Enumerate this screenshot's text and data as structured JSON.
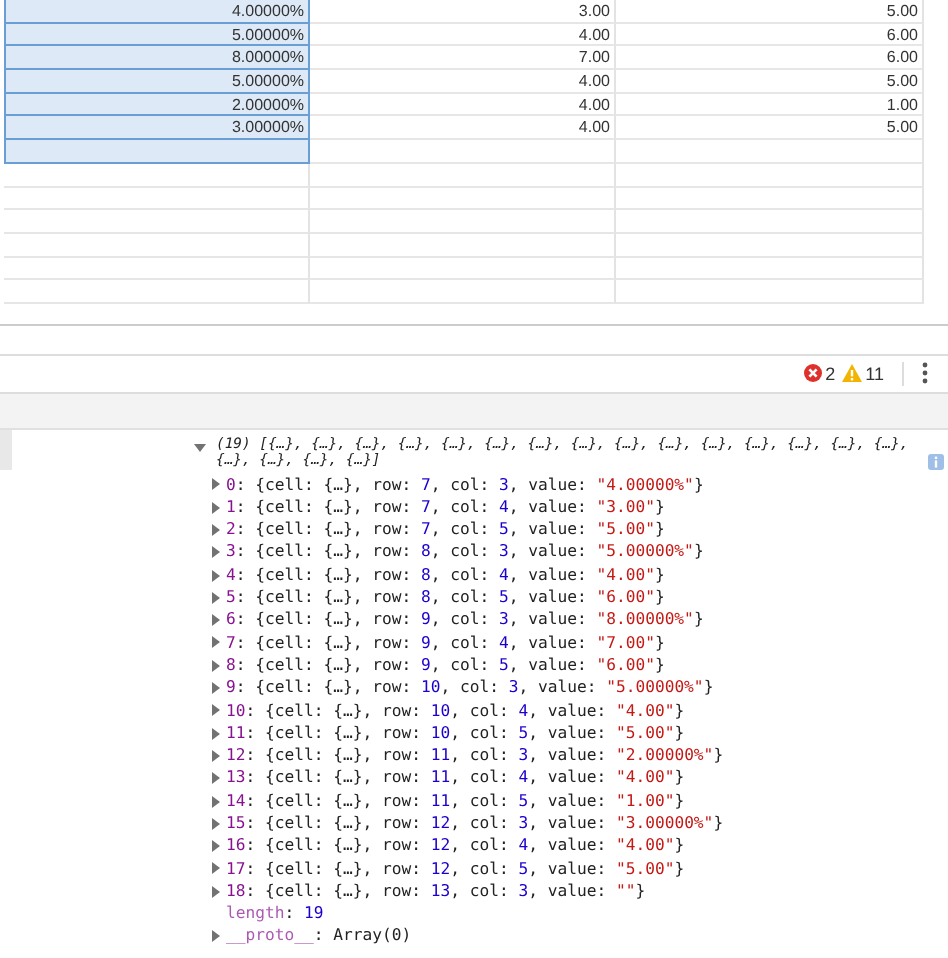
{
  "sheet": {
    "rows": [
      {
        "selected": true,
        "cells": [
          "4.00000%",
          "3.00",
          "5.00"
        ]
      },
      {
        "selected": true,
        "cells": [
          "5.00000%",
          "4.00",
          "6.00"
        ]
      },
      {
        "selected": true,
        "cells": [
          "8.00000%",
          "7.00",
          "6.00"
        ]
      },
      {
        "selected": true,
        "cells": [
          "5.00000%",
          "4.00",
          "5.00"
        ]
      },
      {
        "selected": true,
        "cells": [
          "2.00000%",
          "4.00",
          "1.00"
        ]
      },
      {
        "selected": true,
        "cells": [
          "3.00000%",
          "4.00",
          "5.00"
        ]
      }
    ],
    "empty_rows": [
      {
        "selected": true
      },
      {
        "selected": false
      },
      {
        "selected": false
      },
      {
        "selected": false
      },
      {
        "selected": false
      },
      {
        "selected": false
      },
      {
        "selected": false
      }
    ]
  },
  "devtools": {
    "errors": "2",
    "warnings": "11"
  },
  "console": {
    "header": {
      "expanded": true,
      "text": "(19) [{…}, {…}, {…}, {…}, {…}, {…}, {…}, {…}, {…}, {…}, {…}, {…}, {…}, {…}, {…}, {…}, {…}, {…}, {…}]"
    },
    "entries": [
      {
        "expanded": false,
        "parts": [
          {
            "kind": "index",
            "text": "0"
          },
          {
            "kind": "plain",
            "text": ": {cell: {…}, row: "
          },
          {
            "kind": "number",
            "text": "7"
          },
          {
            "kind": "plain",
            "text": ", col: "
          },
          {
            "kind": "number",
            "text": "3"
          },
          {
            "kind": "plain",
            "text": ", value: "
          },
          {
            "kind": "string",
            "text": "\"4.00000%\""
          },
          {
            "kind": "plain",
            "text": "}"
          }
        ]
      },
      {
        "expanded": false,
        "parts": [
          {
            "kind": "index",
            "text": "1"
          },
          {
            "kind": "plain",
            "text": ": {cell: {…}, row: "
          },
          {
            "kind": "number",
            "text": "7"
          },
          {
            "kind": "plain",
            "text": ", col: "
          },
          {
            "kind": "number",
            "text": "4"
          },
          {
            "kind": "plain",
            "text": ", value: "
          },
          {
            "kind": "string",
            "text": "\"3.00\""
          },
          {
            "kind": "plain",
            "text": "}"
          }
        ]
      },
      {
        "expanded": false,
        "parts": [
          {
            "kind": "index",
            "text": "2"
          },
          {
            "kind": "plain",
            "text": ": {cell: {…}, row: "
          },
          {
            "kind": "number",
            "text": "7"
          },
          {
            "kind": "plain",
            "text": ", col: "
          },
          {
            "kind": "number",
            "text": "5"
          },
          {
            "kind": "plain",
            "text": ", value: "
          },
          {
            "kind": "string",
            "text": "\"5.00\""
          },
          {
            "kind": "plain",
            "text": "}"
          }
        ]
      },
      {
        "expanded": false,
        "parts": [
          {
            "kind": "index",
            "text": "3"
          },
          {
            "kind": "plain",
            "text": ": {cell: {…}, row: "
          },
          {
            "kind": "number",
            "text": "8"
          },
          {
            "kind": "plain",
            "text": ", col: "
          },
          {
            "kind": "number",
            "text": "3"
          },
          {
            "kind": "plain",
            "text": ", value: "
          },
          {
            "kind": "string",
            "text": "\"5.00000%\""
          },
          {
            "kind": "plain",
            "text": "}"
          }
        ]
      },
      {
        "expanded": false,
        "parts": [
          {
            "kind": "index",
            "text": "4"
          },
          {
            "kind": "plain",
            "text": ": {cell: {…}, row: "
          },
          {
            "kind": "number",
            "text": "8"
          },
          {
            "kind": "plain",
            "text": ", col: "
          },
          {
            "kind": "number",
            "text": "4"
          },
          {
            "kind": "plain",
            "text": ", value: "
          },
          {
            "kind": "string",
            "text": "\"4.00\""
          },
          {
            "kind": "plain",
            "text": "}"
          }
        ]
      },
      {
        "expanded": false,
        "parts": [
          {
            "kind": "index",
            "text": "5"
          },
          {
            "kind": "plain",
            "text": ": {cell: {…}, row: "
          },
          {
            "kind": "number",
            "text": "8"
          },
          {
            "kind": "plain",
            "text": ", col: "
          },
          {
            "kind": "number",
            "text": "5"
          },
          {
            "kind": "plain",
            "text": ", value: "
          },
          {
            "kind": "string",
            "text": "\"6.00\""
          },
          {
            "kind": "plain",
            "text": "}"
          }
        ]
      },
      {
        "expanded": false,
        "parts": [
          {
            "kind": "index",
            "text": "6"
          },
          {
            "kind": "plain",
            "text": ": {cell: {…}, row: "
          },
          {
            "kind": "number",
            "text": "9"
          },
          {
            "kind": "plain",
            "text": ", col: "
          },
          {
            "kind": "number",
            "text": "3"
          },
          {
            "kind": "plain",
            "text": ", value: "
          },
          {
            "kind": "string",
            "text": "\"8.00000%\""
          },
          {
            "kind": "plain",
            "text": "}"
          }
        ]
      },
      {
        "expanded": false,
        "parts": [
          {
            "kind": "index",
            "text": "7"
          },
          {
            "kind": "plain",
            "text": ": {cell: {…}, row: "
          },
          {
            "kind": "number",
            "text": "9"
          },
          {
            "kind": "plain",
            "text": ", col: "
          },
          {
            "kind": "number",
            "text": "4"
          },
          {
            "kind": "plain",
            "text": ", value: "
          },
          {
            "kind": "string",
            "text": "\"7.00\""
          },
          {
            "kind": "plain",
            "text": "}"
          }
        ]
      },
      {
        "expanded": false,
        "parts": [
          {
            "kind": "index",
            "text": "8"
          },
          {
            "kind": "plain",
            "text": ": {cell: {…}, row: "
          },
          {
            "kind": "number",
            "text": "9"
          },
          {
            "kind": "plain",
            "text": ", col: "
          },
          {
            "kind": "number",
            "text": "5"
          },
          {
            "kind": "plain",
            "text": ", value: "
          },
          {
            "kind": "string",
            "text": "\"6.00\""
          },
          {
            "kind": "plain",
            "text": "}"
          }
        ]
      },
      {
        "expanded": false,
        "parts": [
          {
            "kind": "index",
            "text": "9"
          },
          {
            "kind": "plain",
            "text": ": {cell: {…}, row: "
          },
          {
            "kind": "number",
            "text": "10"
          },
          {
            "kind": "plain",
            "text": ", col: "
          },
          {
            "kind": "number",
            "text": "3"
          },
          {
            "kind": "plain",
            "text": ", value: "
          },
          {
            "kind": "string",
            "text": "\"5.00000%\""
          },
          {
            "kind": "plain",
            "text": "}"
          }
        ]
      },
      {
        "expanded": false,
        "parts": [
          {
            "kind": "index",
            "text": "10"
          },
          {
            "kind": "plain",
            "text": ": {cell: {…}, row: "
          },
          {
            "kind": "number",
            "text": "10"
          },
          {
            "kind": "plain",
            "text": ", col: "
          },
          {
            "kind": "number",
            "text": "4"
          },
          {
            "kind": "plain",
            "text": ", value: "
          },
          {
            "kind": "string",
            "text": "\"4.00\""
          },
          {
            "kind": "plain",
            "text": "}"
          }
        ]
      },
      {
        "expanded": false,
        "parts": [
          {
            "kind": "index",
            "text": "11"
          },
          {
            "kind": "plain",
            "text": ": {cell: {…}, row: "
          },
          {
            "kind": "number",
            "text": "10"
          },
          {
            "kind": "plain",
            "text": ", col: "
          },
          {
            "kind": "number",
            "text": "5"
          },
          {
            "kind": "plain",
            "text": ", value: "
          },
          {
            "kind": "string",
            "text": "\"5.00\""
          },
          {
            "kind": "plain",
            "text": "}"
          }
        ]
      },
      {
        "expanded": false,
        "parts": [
          {
            "kind": "index",
            "text": "12"
          },
          {
            "kind": "plain",
            "text": ": {cell: {…}, row: "
          },
          {
            "kind": "number",
            "text": "11"
          },
          {
            "kind": "plain",
            "text": ", col: "
          },
          {
            "kind": "number",
            "text": "3"
          },
          {
            "kind": "plain",
            "text": ", value: "
          },
          {
            "kind": "string",
            "text": "\"2.00000%\""
          },
          {
            "kind": "plain",
            "text": "}"
          }
        ]
      },
      {
        "expanded": false,
        "parts": [
          {
            "kind": "index",
            "text": "13"
          },
          {
            "kind": "plain",
            "text": ": {cell: {…}, row: "
          },
          {
            "kind": "number",
            "text": "11"
          },
          {
            "kind": "plain",
            "text": ", col: "
          },
          {
            "kind": "number",
            "text": "4"
          },
          {
            "kind": "plain",
            "text": ", value: "
          },
          {
            "kind": "string",
            "text": "\"4.00\""
          },
          {
            "kind": "plain",
            "text": "}"
          }
        ]
      },
      {
        "expanded": false,
        "parts": [
          {
            "kind": "index",
            "text": "14"
          },
          {
            "kind": "plain",
            "text": ": {cell: {…}, row: "
          },
          {
            "kind": "number",
            "text": "11"
          },
          {
            "kind": "plain",
            "text": ", col: "
          },
          {
            "kind": "number",
            "text": "5"
          },
          {
            "kind": "plain",
            "text": ", value: "
          },
          {
            "kind": "string",
            "text": "\"1.00\""
          },
          {
            "kind": "plain",
            "text": "}"
          }
        ]
      },
      {
        "expanded": false,
        "parts": [
          {
            "kind": "index",
            "text": "15"
          },
          {
            "kind": "plain",
            "text": ": {cell: {…}, row: "
          },
          {
            "kind": "number",
            "text": "12"
          },
          {
            "kind": "plain",
            "text": ", col: "
          },
          {
            "kind": "number",
            "text": "3"
          },
          {
            "kind": "plain",
            "text": ", value: "
          },
          {
            "kind": "string",
            "text": "\"3.00000%\""
          },
          {
            "kind": "plain",
            "text": "}"
          }
        ]
      },
      {
        "expanded": false,
        "parts": [
          {
            "kind": "index",
            "text": "16"
          },
          {
            "kind": "plain",
            "text": ": {cell: {…}, row: "
          },
          {
            "kind": "number",
            "text": "12"
          },
          {
            "kind": "plain",
            "text": ", col: "
          },
          {
            "kind": "number",
            "text": "4"
          },
          {
            "kind": "plain",
            "text": ", value: "
          },
          {
            "kind": "string",
            "text": "\"4.00\""
          },
          {
            "kind": "plain",
            "text": "}"
          }
        ]
      },
      {
        "expanded": false,
        "parts": [
          {
            "kind": "index",
            "text": "17"
          },
          {
            "kind": "plain",
            "text": ": {cell: {…}, row: "
          },
          {
            "kind": "number",
            "text": "12"
          },
          {
            "kind": "plain",
            "text": ", col: "
          },
          {
            "kind": "number",
            "text": "5"
          },
          {
            "kind": "plain",
            "text": ", value: "
          },
          {
            "kind": "string",
            "text": "\"5.00\""
          },
          {
            "kind": "plain",
            "text": "}"
          }
        ]
      },
      {
        "expanded": false,
        "parts": [
          {
            "kind": "index",
            "text": "18"
          },
          {
            "kind": "plain",
            "text": ": {cell: {…}, row: "
          },
          {
            "kind": "number",
            "text": "13"
          },
          {
            "kind": "plain",
            "text": ", col: "
          },
          {
            "kind": "number",
            "text": "3"
          },
          {
            "kind": "plain",
            "text": ", value: "
          },
          {
            "kind": "string",
            "text": "\"\""
          },
          {
            "kind": "plain",
            "text": "}"
          }
        ]
      }
    ],
    "length": {
      "key": "length",
      "sep": ": ",
      "value": "19"
    },
    "proto": {
      "expanded": false,
      "key": "__proto__",
      "rest": ": Array(0)"
    }
  }
}
